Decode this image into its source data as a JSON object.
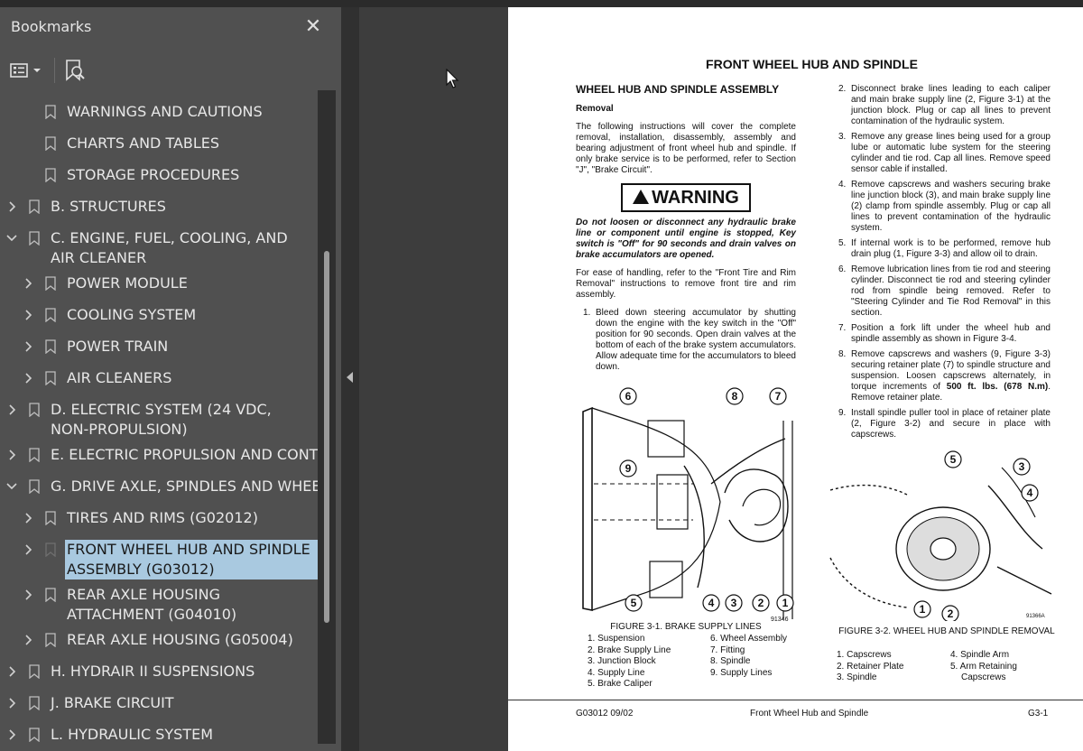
{
  "bookmarks_panel": {
    "title": "Bookmarks",
    "close_symbol": "✕",
    "toolbar": {
      "options_icon": "list-options-icon",
      "find_icon": "find-bookmark-icon"
    },
    "items": [
      {
        "label": "WARNINGS AND CAUTIONS",
        "level": 1,
        "expandable": false
      },
      {
        "label": "CHARTS AND TABLES",
        "level": 1,
        "expandable": false
      },
      {
        "label": "STORAGE PROCEDURES",
        "level": 1,
        "expandable": false
      },
      {
        "label": "B. STRUCTURES",
        "level": 0,
        "expandable": true,
        "expanded": false
      },
      {
        "label": "C. ENGINE, FUEL, COOLING, AND AIR CLEANER",
        "level": 0,
        "expandable": true,
        "expanded": true
      },
      {
        "label": "POWER MODULE",
        "level": 1,
        "expandable": true,
        "expanded": false
      },
      {
        "label": "COOLING SYSTEM",
        "level": 1,
        "expandable": true,
        "expanded": false
      },
      {
        "label": "POWER TRAIN",
        "level": 1,
        "expandable": true,
        "expanded": false
      },
      {
        "label": "AIR CLEANERS",
        "level": 1,
        "expandable": true,
        "expanded": false
      },
      {
        "label": "D. ELECTRIC SYSTEM (24 VDC, NON-PROPULSION)",
        "level": 0,
        "expandable": true,
        "expanded": false
      },
      {
        "label": "E. ELECTRIC PROPULSION AND CONTROL",
        "level": 0,
        "expandable": true,
        "expanded": false
      },
      {
        "label": "G. DRIVE AXLE, SPINDLES AND WHEELS",
        "level": 0,
        "expandable": true,
        "expanded": true
      },
      {
        "label": "TIRES AND RIMS (G02012)",
        "level": 1,
        "expandable": true,
        "expanded": false
      },
      {
        "label": "FRONT WHEEL HUB AND SPINDLE ASSEMBLY (G03012)",
        "level": 1,
        "expandable": true,
        "expanded": false,
        "selected": true
      },
      {
        "label": "REAR AXLE HOUSING ATTACHMENT (G04010)",
        "level": 1,
        "expandable": true,
        "expanded": false
      },
      {
        "label": "REAR AXLE HOUSING (G05004)",
        "level": 1,
        "expandable": true,
        "expanded": false
      },
      {
        "label": "H. HYDRAIR II SUSPENSIONS",
        "level": 0,
        "expandable": true,
        "expanded": false
      },
      {
        "label": "J. BRAKE CIRCUIT",
        "level": 0,
        "expandable": true,
        "expanded": false
      },
      {
        "label": "L. HYDRAULIC SYSTEM",
        "level": 0,
        "expandable": true,
        "expanded": false
      }
    ]
  },
  "document": {
    "page_title": "FRONT WHEEL HUB AND SPINDLE",
    "section_heading": "WHEEL HUB AND SPINDLE ASSEMBLY",
    "subheading": "Removal",
    "intro": "The following instructions will cover the complete removal, installation, disassembly, assembly and bearing adjustment of front wheel hub and spindle. If only brake service is to be performed, refer to Section \"J\", \"Brake Circuit\".",
    "warning_label": "WARNING",
    "warning_text": "Do not loosen or disconnect any hydraulic brake line or component until engine is stopped, Key switch is \"Off\" for 90 seconds and drain valves on brake accumulators are opened.",
    "handling": "For ease of handling, refer to the \"Front Tire and Rim Removal\" instructions to remove front tire and rim assembly.",
    "steps": [
      {
        "n": "1.",
        "text": "Bleed down steering accumulator by shutting down the engine with the key switch in the \"Off\" position for 90 seconds. Open drain valves at the bottom of each of the brake system accumulators. Allow adequate time for the accumulators to bleed down."
      },
      {
        "n": "2.",
        "text": "Disconnect brake lines leading to each caliper and main brake supply line (2, Figure 3-1) at the junction block. Plug or cap all lines to prevent contamination of the hydraulic system."
      },
      {
        "n": "3.",
        "text": "Remove any grease lines being used for a group lube or automatic lube system for the steering cylinder and tie rod. Cap all lines. Remove speed sensor cable if installed."
      },
      {
        "n": "4.",
        "text": "Remove capscrews and washers securing brake line junction block (3), and main brake supply line (2) clamp from spindle assembly. Plug or cap all lines to prevent contamination of the hydraulic system."
      },
      {
        "n": "5.",
        "text": "If internal work is to be performed, remove hub drain plug (1, Figure 3-3) and allow oil to drain."
      },
      {
        "n": "6.",
        "text": "Remove lubrication lines from tie rod and steering cylinder. Disconnect tie rod and steering cylinder rod from spindle being removed. Refer to \"Steering Cylinder and Tie Rod Removal\" in this section."
      },
      {
        "n": "7.",
        "text": "Position a fork lift under the wheel hub and spindle assembly as shown in Figure 3-4."
      },
      {
        "n": "8.",
        "text_before": "Remove capscrews and washers (9, Figure 3-3) securing retainer plate (7) to spindle structure and suspension. Loosen capscrews alternately, in torque increments of ",
        "text_bold": "500 ft. lbs. (678 N.m)",
        "text_after": ". Remove retainer plate."
      },
      {
        "n": "9.",
        "text": "Install spindle puller tool in place of retainer plate (2, Figure 3-2) and secure in place with capscrews."
      }
    ],
    "figure1": {
      "caption": "FIGURE 3-1. BRAKE SUPPLY LINES",
      "callouts": [
        "6",
        "8",
        "7",
        "9",
        "5",
        "4",
        "3",
        "2",
        "1"
      ],
      "code": "91346",
      "legend_left": [
        "1. Suspension",
        "2. Brake Supply Line",
        "3. Junction Block",
        "4. Supply Line",
        "5. Brake Caliper"
      ],
      "legend_right": [
        "6. Wheel Assembly",
        "7. Fitting",
        "8. Spindle",
        "9. Supply Lines"
      ]
    },
    "figure2": {
      "caption": "FIGURE 3-2. WHEEL HUB AND SPINDLE REMOVAL",
      "callouts": [
        "5",
        "3",
        "4",
        "1",
        "2"
      ],
      "code": "91366A",
      "legend_left": [
        "1. Capscrews",
        "2. Retainer Plate",
        "3. Spindle"
      ],
      "legend_right": [
        "4. Spindle Arm",
        "5. Arm Retaining",
        "Capscrews"
      ]
    },
    "footer": {
      "left": "G03012  09/02",
      "center": "Front Wheel Hub and Spindle",
      "right": "G3-1"
    }
  }
}
